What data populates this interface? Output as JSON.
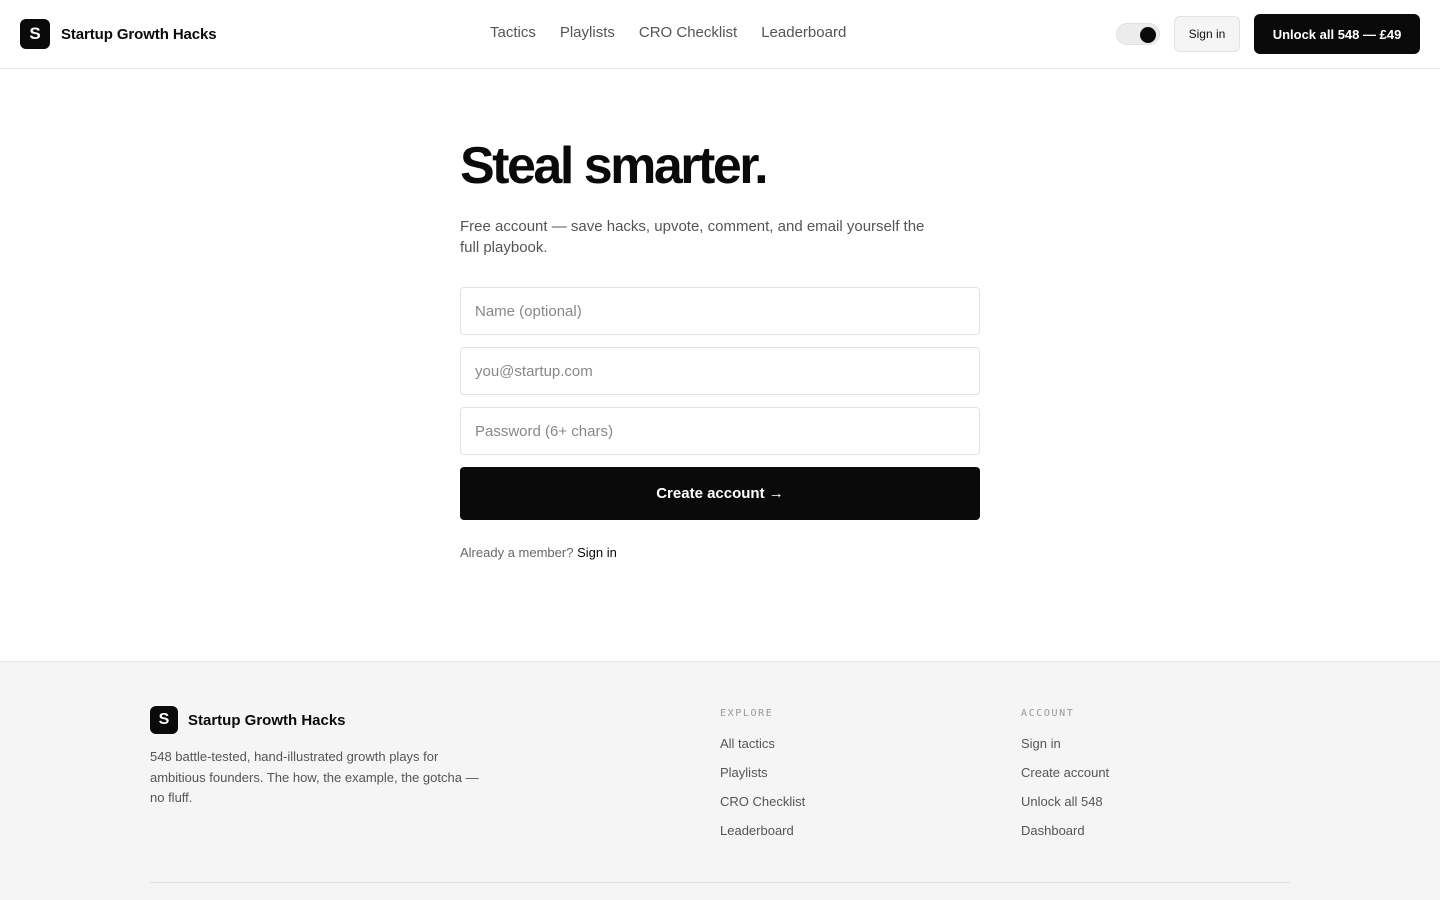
{
  "header": {
    "logo_letter": "S",
    "brand": "Startup Growth Hacks",
    "nav": [
      "Tactics",
      "Playlists",
      "CRO Checklist",
      "Leaderboard"
    ],
    "signin_label": "Sign in",
    "unlock_label": "Unlock all 548 — £49"
  },
  "main": {
    "headline": "Steal smarter.",
    "subtitle": "Free account — save hacks, upvote, comment, and email yourself the full playbook.",
    "name_placeholder": "Name (optional)",
    "email_placeholder": "you@startup.com",
    "password_placeholder": "Password (6+ chars)",
    "create_label": "Create account →",
    "member_text": "Already a member?",
    "member_link": "Sign in"
  },
  "footer": {
    "logo_letter": "S",
    "brand": "Startup Growth Hacks",
    "description": "548 battle-tested, hand-illustrated growth plays for ambitious founders. The how, the example, the gotcha — no fluff.",
    "explore_title": "EXPLORE",
    "explore_links": [
      "All tactics",
      "Playlists",
      "CRO Checklist",
      "Leaderboard"
    ],
    "account_title": "ACCOUNT",
    "account_links": [
      "Sign in",
      "Create account",
      "Unlock all 548",
      "Dashboard"
    ]
  },
  "colors": {
    "accent": "#0a0a0a",
    "footer_bg": "#f5f5f5"
  }
}
